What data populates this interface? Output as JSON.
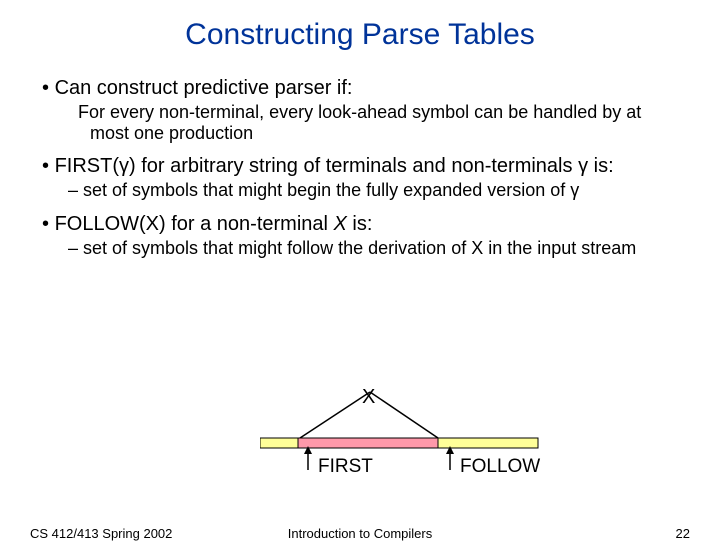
{
  "title": "Constructing Parse Tables",
  "b1": {
    "text": "Can construct predictive parser if:",
    "sub": "For every non-terminal, every look-ahead symbol can be handled by at most one production"
  },
  "b2": {
    "pre": "FIRST(",
    "gamma1": "γ",
    "mid": ") for arbitrary string of terminals and non-terminals ",
    "gamma2": "γ",
    "post": " is:",
    "sub_pre": "set of symbols that might begin the fully expanded version of ",
    "sub_gamma": "γ"
  },
  "b3": {
    "pre": "FOLLOW(X) for a non-terminal ",
    "x": "X",
    "post": " is:",
    "sub": "set of symbols that might follow the derivation of X in the input stream"
  },
  "diagram": {
    "x_label": "X",
    "first_label": "FIRST",
    "follow_label": "FOLLOW"
  },
  "footer": {
    "left": "CS 412/413   Spring 2002",
    "center": "Introduction to Compilers",
    "right": "22"
  }
}
